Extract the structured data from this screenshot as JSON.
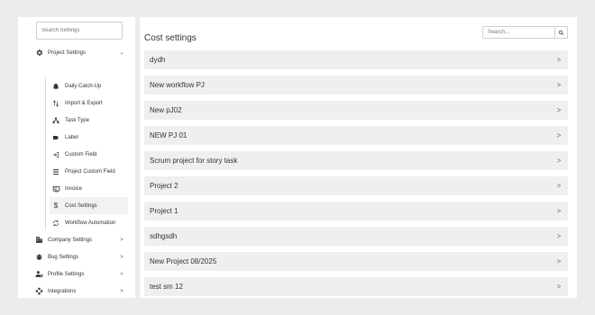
{
  "sidebar": {
    "search_placeholder": "Search Settings",
    "project_settings": {
      "label": "Project Settings",
      "chevron": "⌄"
    },
    "sub_items": [
      {
        "label": "Daily Catch-Up",
        "icon": "bell-icon"
      },
      {
        "label": "Import & Export",
        "icon": "import-export-icon"
      },
      {
        "label": "Task Type",
        "icon": "task-type-icon"
      },
      {
        "label": "Label",
        "icon": "label-icon"
      },
      {
        "label": "Custom Field",
        "icon": "custom-field-icon"
      },
      {
        "label": "Project Custom Field",
        "icon": "list-icon"
      },
      {
        "label": "Invoice",
        "icon": "invoice-icon"
      },
      {
        "label": "Cost Settings",
        "icon": "dollar-icon"
      },
      {
        "label": "Workflow Automation",
        "icon": "workflow-icon"
      }
    ],
    "top_items": [
      {
        "label": "Company Settings",
        "icon": "building-icon",
        "chevron": ">"
      },
      {
        "label": "Bug Settings",
        "icon": "bug-icon",
        "chevron": ">"
      },
      {
        "label": "Profile Settings",
        "icon": "profile-icon",
        "chevron": ">"
      },
      {
        "label": "Integrations",
        "icon": "integrations-icon",
        "chevron": ">"
      }
    ]
  },
  "main": {
    "title": "Cost settings",
    "search_placeholder": "Search...",
    "projects": [
      "dydh",
      "New workflow PJ",
      "New pJ02",
      "NEW PJ 01",
      "Scrum project for story task",
      "Project 2",
      "Project 1",
      "sdhgsdh",
      "New Project 08/2025",
      "test sm 12"
    ],
    "row_arrow": ">"
  },
  "colors": {
    "page_bg": "#ececec",
    "panel_bg": "#ffffff",
    "row_bg": "#efefef",
    "active_bg": "#f2f2f2"
  }
}
